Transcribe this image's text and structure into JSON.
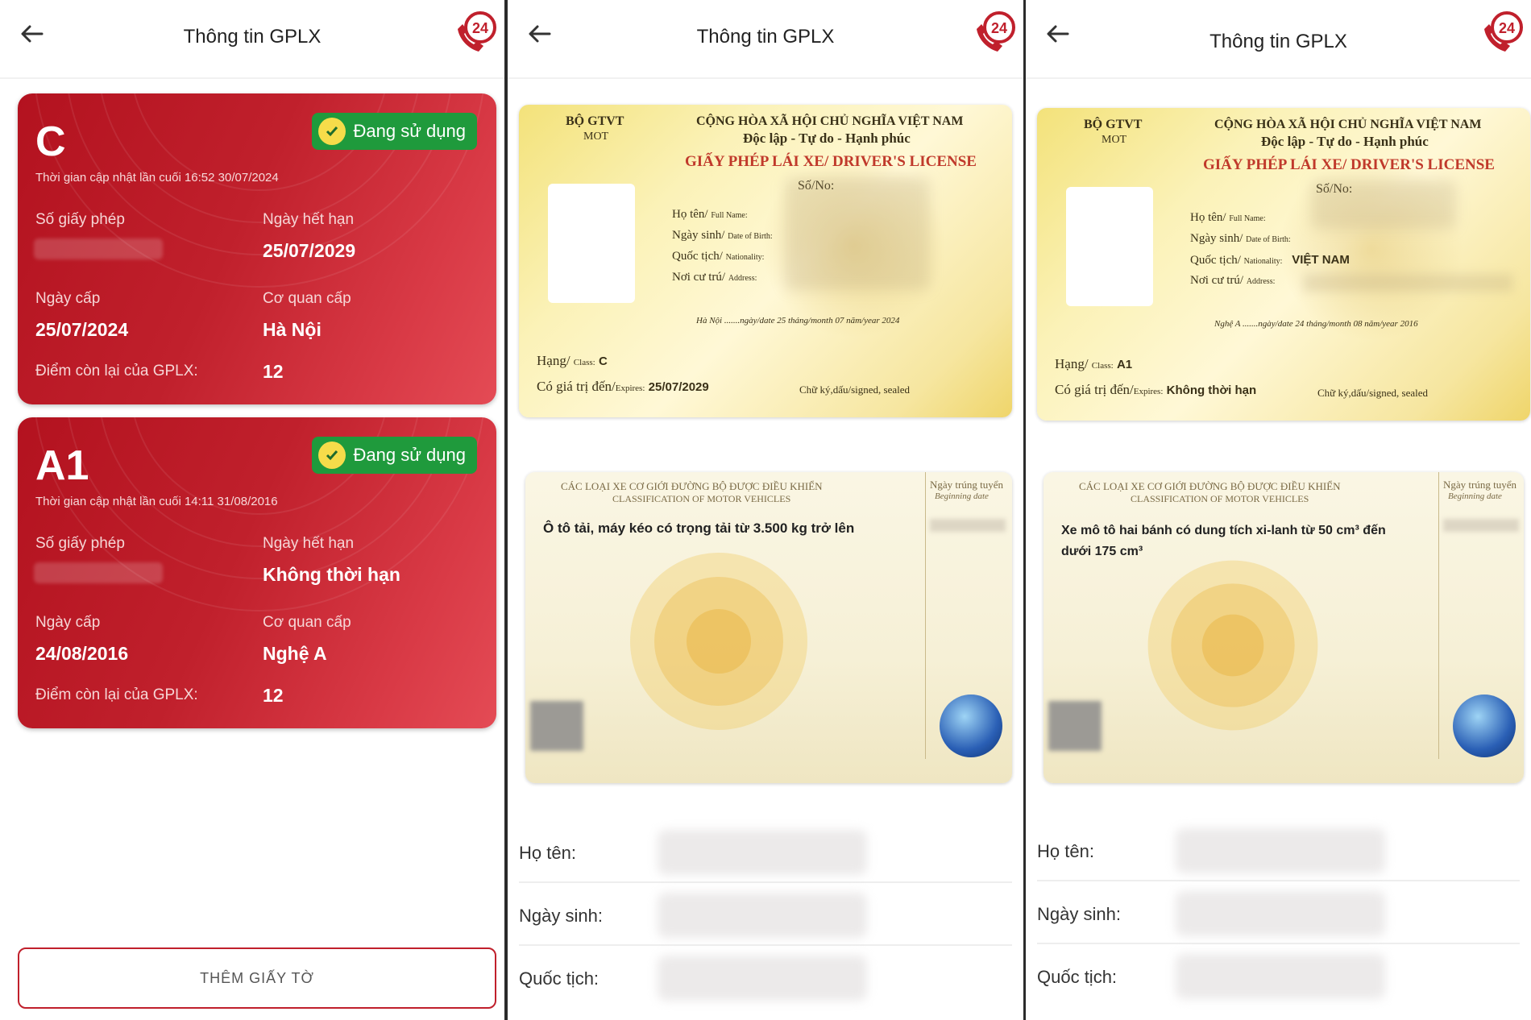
{
  "header": {
    "title": "Thông tin GPLX",
    "hotline_number": "24"
  },
  "licenses": [
    {
      "class": "C",
      "status": "Đang sử dụng",
      "updated": "Thời gian cập nhật lần cuối 16:52 30/07/2024",
      "license_no_label": "Số giấy phép",
      "expiry_label": "Ngày hết hạn",
      "expiry": "25/07/2029",
      "issue_date_label": "Ngày cấp",
      "issue_date": "25/07/2024",
      "issuer_label": "Cơ quan cấp",
      "issuer": "Hà Nội",
      "points_label": "Điểm còn lại của GPLX:",
      "points": "12"
    },
    {
      "class": "A1",
      "status": "Đang sử dụng",
      "updated": "Thời gian cập nhật lần cuối 14:11 31/08/2016",
      "license_no_label": "Số giấy phép",
      "expiry_label": "Ngày hết hạn",
      "expiry": "Không thời hạn",
      "issue_date_label": "Ngày cấp",
      "issue_date": "24/08/2016",
      "issuer_label": "Cơ quan cấp",
      "issuer": "Nghệ A",
      "points_label": "Điểm còn lại của GPLX:",
      "points": "12"
    }
  ],
  "add_button": "THÊM GIẤY TỜ",
  "card_common": {
    "ministry": "BỘ GTVT",
    "ministry_en": "MOT",
    "republic": "CỘNG HÒA XÃ HỘI CHỦ NGHĨA VIỆT NAM",
    "motto": "Độc lập - Tự do - Hạnh phúc",
    "license_title": "GIẤY PHÉP LÁI XE/ DRIVER'S LICENSE",
    "so_no": "Số/No:",
    "fullname_label": "Họ tên/",
    "fullname_en": "Full Name:",
    "dob_label": "Ngày sinh/",
    "dob_en": "Date of Birth:",
    "nationality_label": "Quốc tịch/",
    "nationality_en": "Nationality:",
    "address_label": "Nơi cư trú/",
    "address_en": "Address:",
    "class_label": "Hạng/",
    "class_en": "Class:",
    "valid_label": "Có giá trị đến/",
    "valid_en": "Expires:",
    "signed": "Chữ ký,dấu/signed, sealed",
    "back_title": "CÁC LOẠI XE CƠ GIỚI ĐƯỜNG BỘ ĐƯỢC ĐIỀU KHIỂN",
    "back_title_en": "CLASSIFICATION OF MOTOR VEHICLES",
    "beginning": "Ngày trúng tuyển",
    "beginning_en": "Beginning date"
  },
  "cards": [
    {
      "issue_line": "Hà Nội .......ngày/date 25 tháng/month 07 năm/year 2024",
      "class": "C",
      "expires": "25/07/2029",
      "nationality": "",
      "vehicle_desc": "Ô tô tải, máy kéo có trọng tải từ 3.500 kg trở lên"
    },
    {
      "issue_line": "Nghệ A .......ngày/date 24 tháng/month 08 năm/year 2016",
      "class": "A1",
      "expires": "Không thời hạn",
      "nationality": "VIỆT NAM",
      "vehicle_desc": "Xe mô tô hai bánh có dung tích xi-lanh từ 50 cm³ đến dưới 175 cm³"
    }
  ],
  "info_labels": {
    "name": "Họ tên:",
    "dob": "Ngày sinh:",
    "nationality": "Quốc tịch:"
  },
  "colors": {
    "card_red": "#c0202c",
    "badge_green": "#1f9a3c",
    "license_yellow": "#f6e6a0"
  },
  "icons": [
    "back-arrow-icon",
    "hotline-24-icon",
    "check-icon"
  ]
}
